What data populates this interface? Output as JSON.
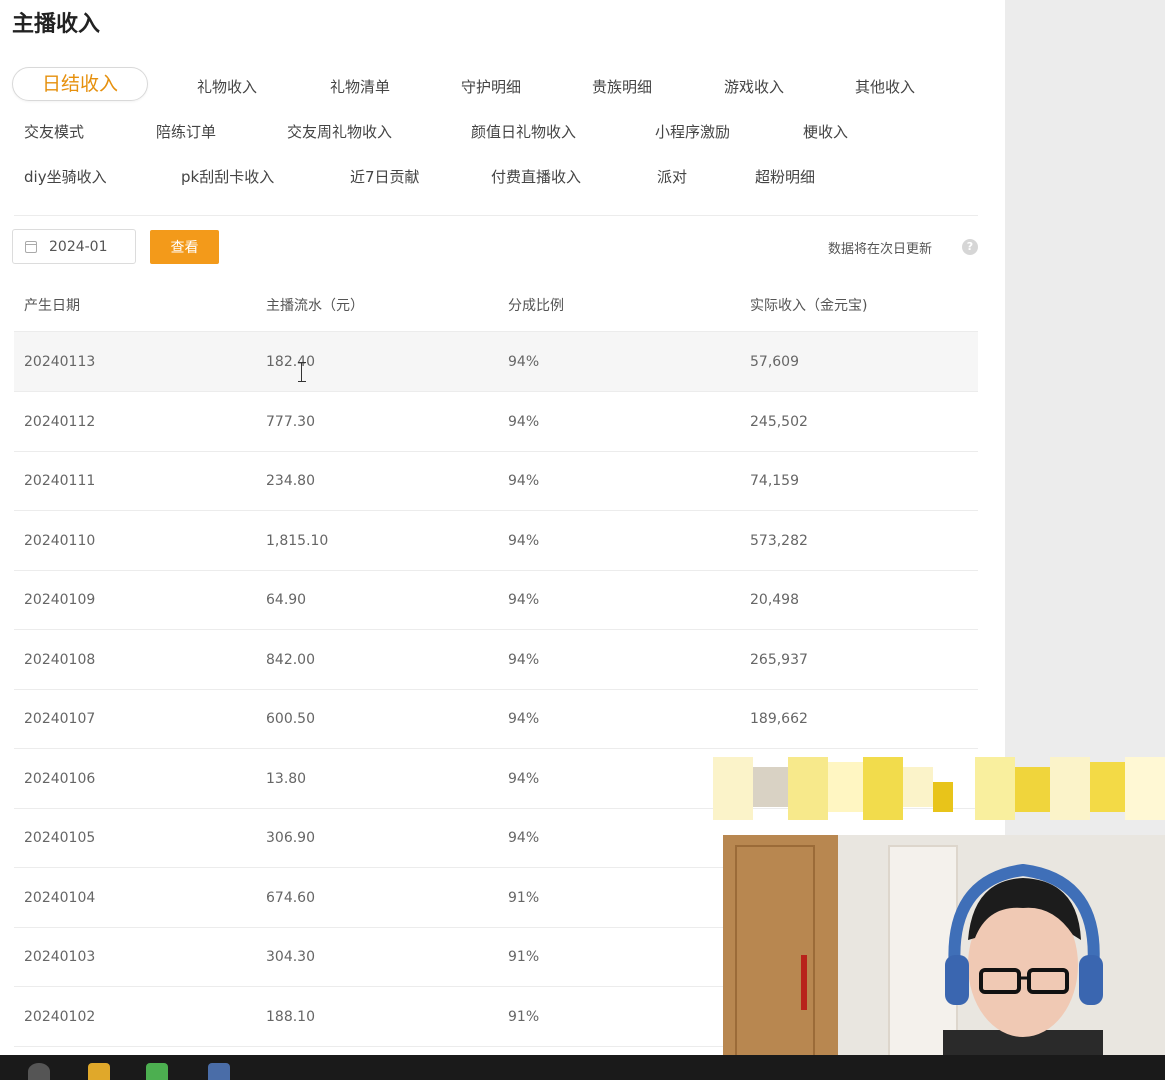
{
  "title": "主播收入",
  "tabs": [
    {
      "label": "日结收入",
      "active": true
    },
    {
      "label": "礼物收入"
    },
    {
      "label": "礼物清单"
    },
    {
      "label": "守护明细"
    },
    {
      "label": "贵族明细"
    },
    {
      "label": "游戏收入"
    },
    {
      "label": "其他收入"
    },
    {
      "label": "交友模式"
    },
    {
      "label": "陪练订单"
    },
    {
      "label": "交友周礼物收入"
    },
    {
      "label": "颜值日礼物收入"
    },
    {
      "label": "小程序激励"
    },
    {
      "label": "梗收入"
    },
    {
      "label": "diy坐骑收入"
    },
    {
      "label": "pk刮刮卡收入"
    },
    {
      "label": "近7日贡献"
    },
    {
      "label": "付费直播收入"
    },
    {
      "label": "派对"
    },
    {
      "label": "超粉明细"
    }
  ],
  "filter": {
    "month": "2024-01",
    "view_label": "查看",
    "note": "数据将在次日更新"
  },
  "table": {
    "headers": [
      "产生日期",
      "主播流水（元）",
      "分成比例",
      "实际收入（金元宝)"
    ],
    "rows": [
      [
        "20240113",
        "182.40",
        "94%",
        "57,609"
      ],
      [
        "20240112",
        "777.30",
        "94%",
        "245,502"
      ],
      [
        "20240111",
        "234.80",
        "94%",
        "74,159"
      ],
      [
        "20240110",
        "1,815.10",
        "94%",
        "573,282"
      ],
      [
        "20240109",
        "64.90",
        "94%",
        "20,498"
      ],
      [
        "20240108",
        "842.00",
        "94%",
        "265,937"
      ],
      [
        "20240107",
        "600.50",
        "94%",
        "189,662"
      ],
      [
        "20240106",
        "13.80",
        "94%",
        ""
      ],
      [
        "20240105",
        "306.90",
        "94%",
        ""
      ],
      [
        "20240104",
        "674.60",
        "91%",
        ""
      ],
      [
        "20240103",
        "304.30",
        "91%",
        ""
      ],
      [
        "20240102",
        "188.10",
        "91%",
        ""
      ]
    ]
  },
  "colors": {
    "accent": "#f39a1a",
    "active_tab_text": "#e6900d"
  },
  "icons": [
    "calendar-icon",
    "help-icon",
    "text-cursor-icon"
  ]
}
